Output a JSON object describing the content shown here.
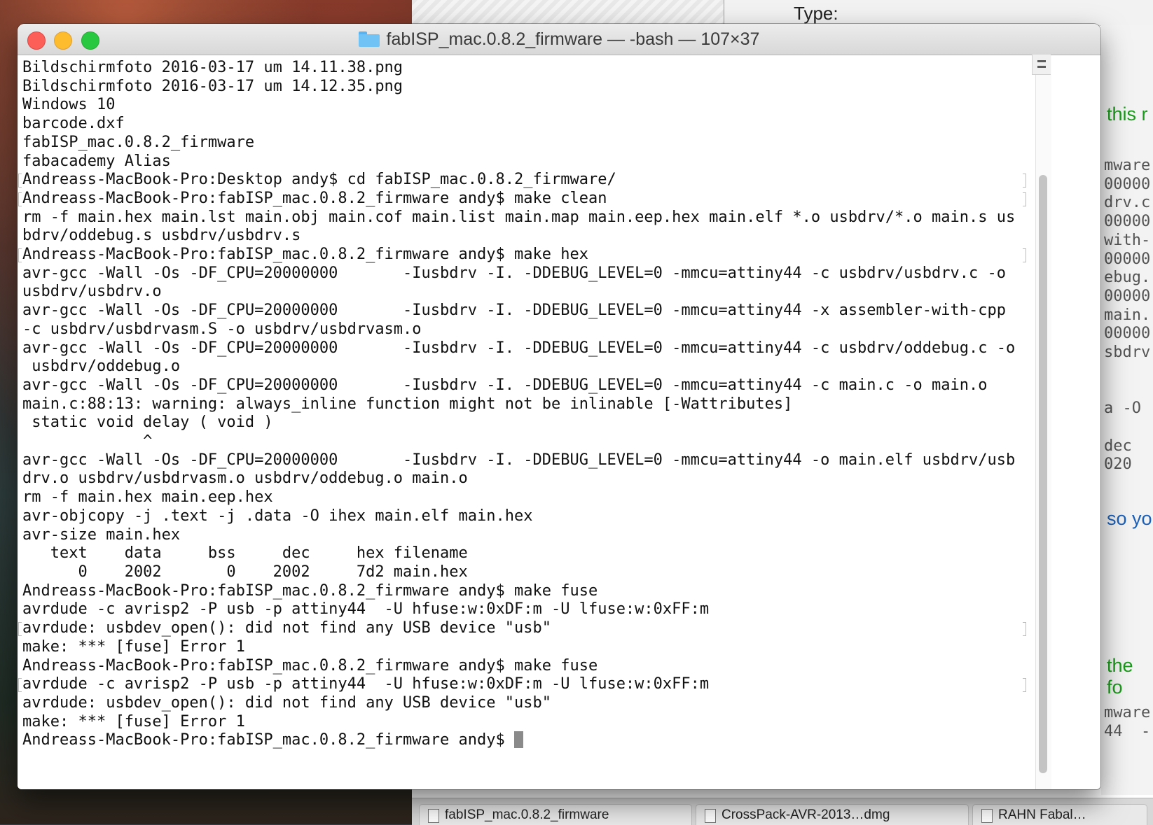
{
  "background_window": {
    "type_label": "Type:",
    "side_text_green_1": "this r",
    "side_text_blue": "so yo",
    "side_text_green_2": "the fo",
    "side_mono_lines": [
      "mware",
      "00000",
      "drv.c",
      "00000",
      "with-",
      "00000",
      "ebug.",
      "00000",
      "main.",
      "00000",
      "sbdrv",
      "",
      "",
      "a -O",
      "",
      "dec",
      "020"
    ],
    "bottom_mono_lines": [
      "mware",
      "44  -"
    ],
    "tabs": [
      "fabISP_mac.0.8.2_firmware",
      "CrossPack-AVR-2013…dmg",
      "RAHN Fabal…"
    ]
  },
  "terminal": {
    "title": "fabISP_mac.0.8.2_firmware — -bash — 107×37",
    "lines": [
      "Bildschirmfoto 2016-03-17 um 14.11.38.png",
      "Bildschirmfoto 2016-03-17 um 14.12.35.png",
      "Windows 10",
      "barcode.dxf",
      "fabISP_mac.0.8.2_firmware",
      "fabacademy Alias",
      "Andreass-MacBook-Pro:Desktop andy$ cd fabISP_mac.0.8.2_firmware/",
      "Andreass-MacBook-Pro:fabISP_mac.0.8.2_firmware andy$ make clean",
      "rm -f main.hex main.lst main.obj main.cof main.list main.map main.eep.hex main.elf *.o usbdrv/*.o main.s us",
      "bdrv/oddebug.s usbdrv/usbdrv.s",
      "Andreass-MacBook-Pro:fabISP_mac.0.8.2_firmware andy$ make hex",
      "avr-gcc -Wall -Os -DF_CPU=20000000       -Iusbdrv -I. -DDEBUG_LEVEL=0 -mmcu=attiny44 -c usbdrv/usbdrv.c -o",
      "usbdrv/usbdrv.o",
      "avr-gcc -Wall -Os -DF_CPU=20000000       -Iusbdrv -I. -DDEBUG_LEVEL=0 -mmcu=attiny44 -x assembler-with-cpp",
      "-c usbdrv/usbdrvasm.S -o usbdrv/usbdrvasm.o",
      "avr-gcc -Wall -Os -DF_CPU=20000000       -Iusbdrv -I. -DDEBUG_LEVEL=0 -mmcu=attiny44 -c usbdrv/oddebug.c -o",
      " usbdrv/oddebug.o",
      "avr-gcc -Wall -Os -DF_CPU=20000000       -Iusbdrv -I. -DDEBUG_LEVEL=0 -mmcu=attiny44 -c main.c -o main.o",
      "main.c:88:13: warning: always_inline function might not be inlinable [-Wattributes]",
      " static void delay ( void )",
      "             ^",
      "avr-gcc -Wall -Os -DF_CPU=20000000       -Iusbdrv -I. -DDEBUG_LEVEL=0 -mmcu=attiny44 -o main.elf usbdrv/usb",
      "drv.o usbdrv/usbdrvasm.o usbdrv/oddebug.o main.o",
      "rm -f main.hex main.eep.hex",
      "avr-objcopy -j .text -j .data -O ihex main.elf main.hex",
      "avr-size main.hex",
      "   text    data     bss     dec     hex filename",
      "      0    2002       0    2002     7d2 main.hex",
      "Andreass-MacBook-Pro:fabISP_mac.0.8.2_firmware andy$ make fuse",
      "avrdude -c avrisp2 -P usb -p attiny44  -U hfuse:w:0xDF:m -U lfuse:w:0xFF:m",
      "avrdude: usbdev_open(): did not find any USB device \"usb\"",
      "make: *** [fuse] Error 1",
      "Andreass-MacBook-Pro:fabISP_mac.0.8.2_firmware andy$ make fuse",
      "avrdude -c avrisp2 -P usb -p attiny44  -U hfuse:w:0xDF:m -U lfuse:w:0xFF:m",
      "avrdude: usbdev_open(): did not find any USB device \"usb\"",
      "make: *** [fuse] Error 1"
    ],
    "prompt": "Andreass-MacBook-Pro:fabISP_mac.0.8.2_firmware andy$ ",
    "marked_lines": [
      6,
      7,
      10,
      30,
      33
    ]
  }
}
